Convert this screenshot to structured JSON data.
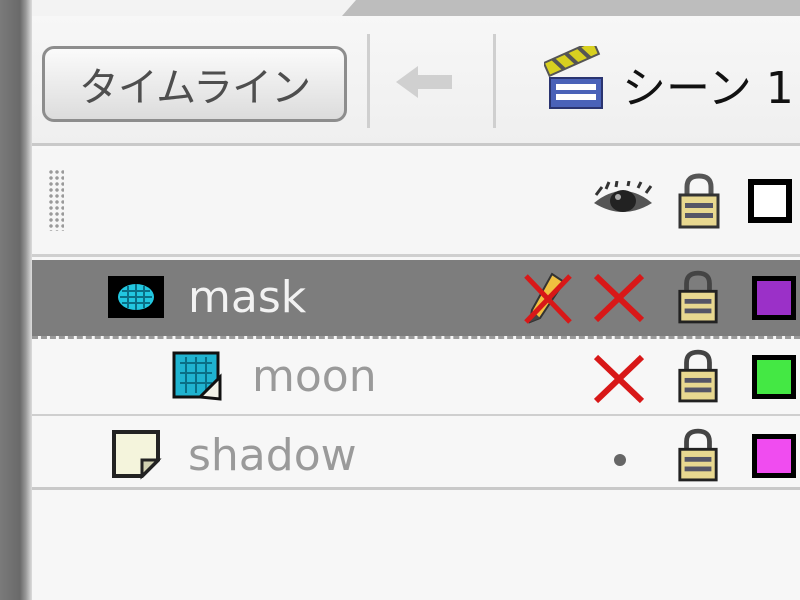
{
  "toolbar": {
    "timeline_label": "タイムライン",
    "scene_label": "シーン 1"
  },
  "layers": [
    {
      "name": "mask",
      "type": "mask",
      "selected": true,
      "visible": false,
      "locked": true,
      "editing": true,
      "color": "#9b30c8"
    },
    {
      "name": "moon",
      "type": "masked",
      "selected": false,
      "visible": false,
      "locked": true,
      "editing": false,
      "color": "#44e844"
    },
    {
      "name": "shadow",
      "type": "normal",
      "selected": false,
      "visible": true,
      "locked": true,
      "editing": false,
      "color": "#f04cf0"
    }
  ],
  "icons": {
    "header_eye": "eye-icon",
    "header_lock": "lock-icon",
    "header_outline": "outline-icon",
    "scene": "clapperboard-icon",
    "back": "back-arrow-icon"
  }
}
